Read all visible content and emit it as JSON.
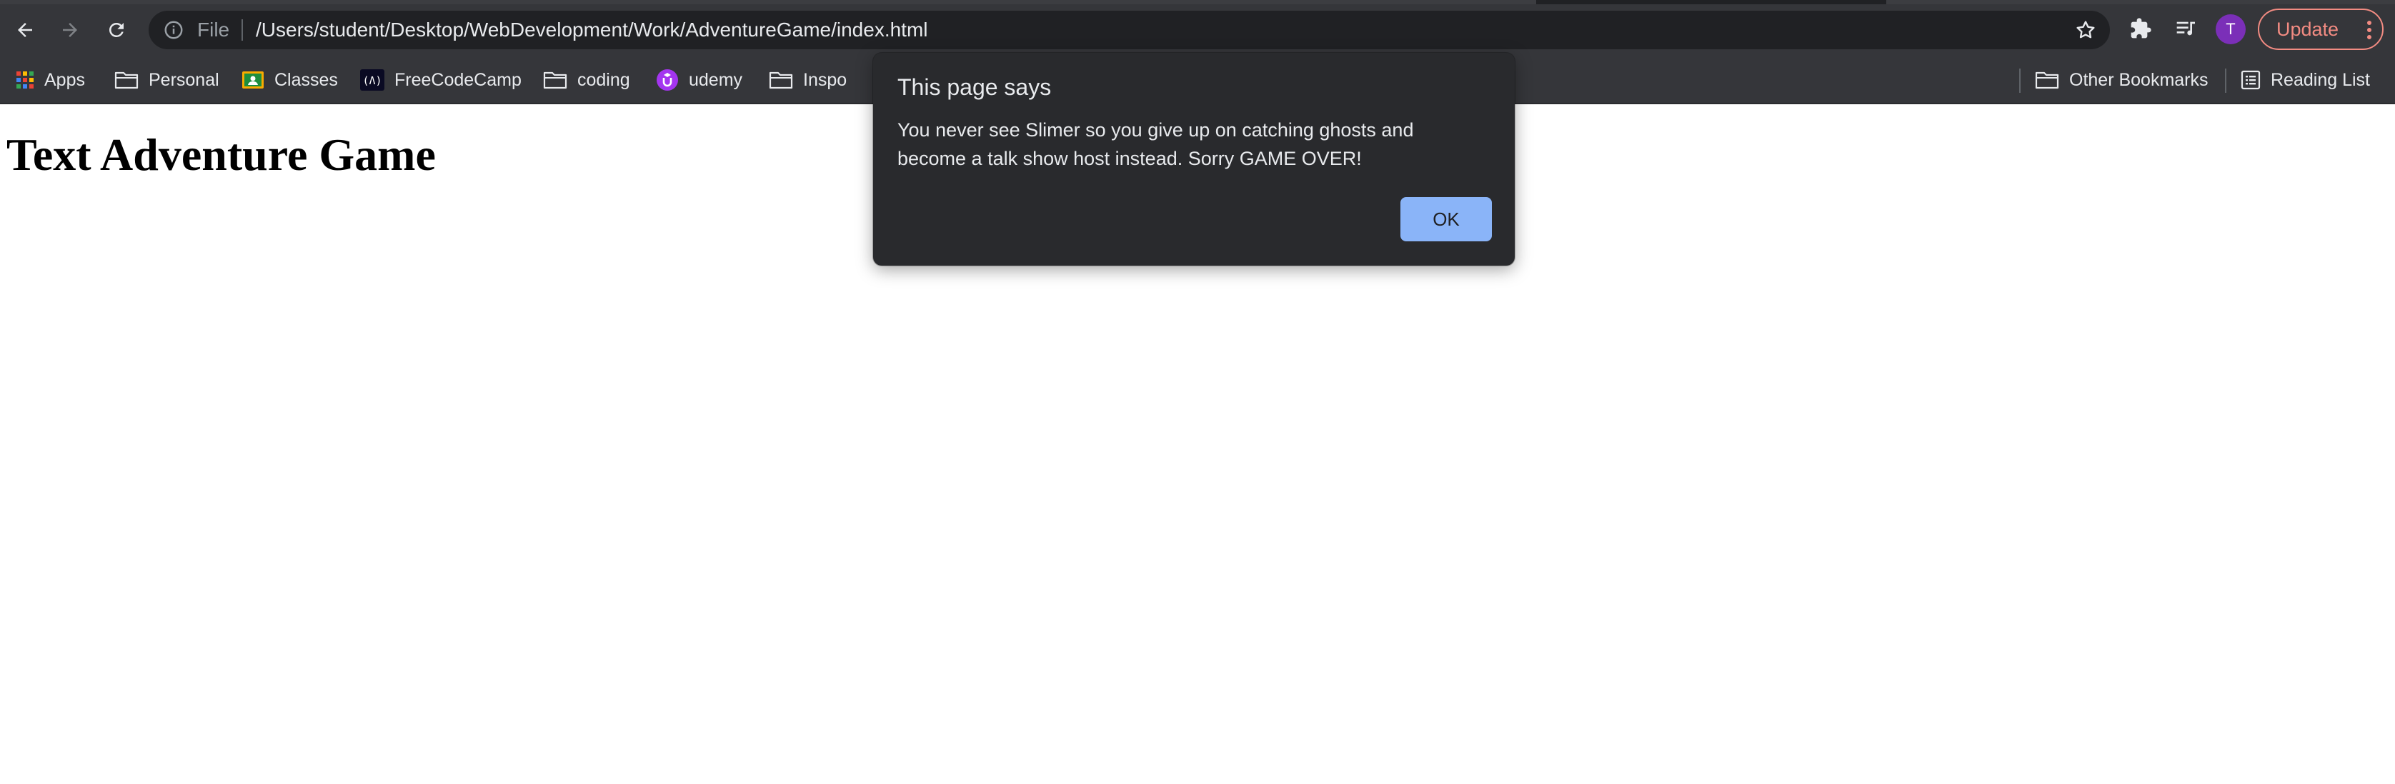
{
  "browser": {
    "omnibox": {
      "scheme_label": "File",
      "url": "/Users/student/Desktop/WebDevelopment/Work/AdventureGame/index.html"
    },
    "profile_initial": "T",
    "update_label": "Update"
  },
  "bookmarks": {
    "items": [
      {
        "label": "Apps",
        "icon": "apps-grid-icon"
      },
      {
        "label": "Personal",
        "icon": "folder-icon"
      },
      {
        "label": "Classes",
        "icon": "classroom-icon"
      },
      {
        "label": "FreeCodeCamp",
        "icon": "freecodecamp-icon"
      },
      {
        "label": "coding",
        "icon": "folder-icon"
      },
      {
        "label": "udemy",
        "icon": "udemy-icon"
      },
      {
        "label": "Inspo",
        "icon": "folder-icon"
      }
    ],
    "right_items": [
      {
        "label": "Other Bookmarks",
        "icon": "folder-icon"
      },
      {
        "label": "Reading List",
        "icon": "reading-list-icon"
      }
    ]
  },
  "page": {
    "heading": "Text Adventure Game"
  },
  "dialog": {
    "title": "This page says",
    "message": "You never see Slimer so you give up on catching ghosts and become a talk show host instead. Sorry GAME OVER!",
    "ok_label": "OK"
  },
  "colors": {
    "toolbar": "#35363a",
    "omnibox": "#202124",
    "dialog_bg": "#292a2d",
    "ok_button": "#8ab4f8",
    "update_accent": "#f28b82",
    "avatar": "#7b2fb8"
  }
}
